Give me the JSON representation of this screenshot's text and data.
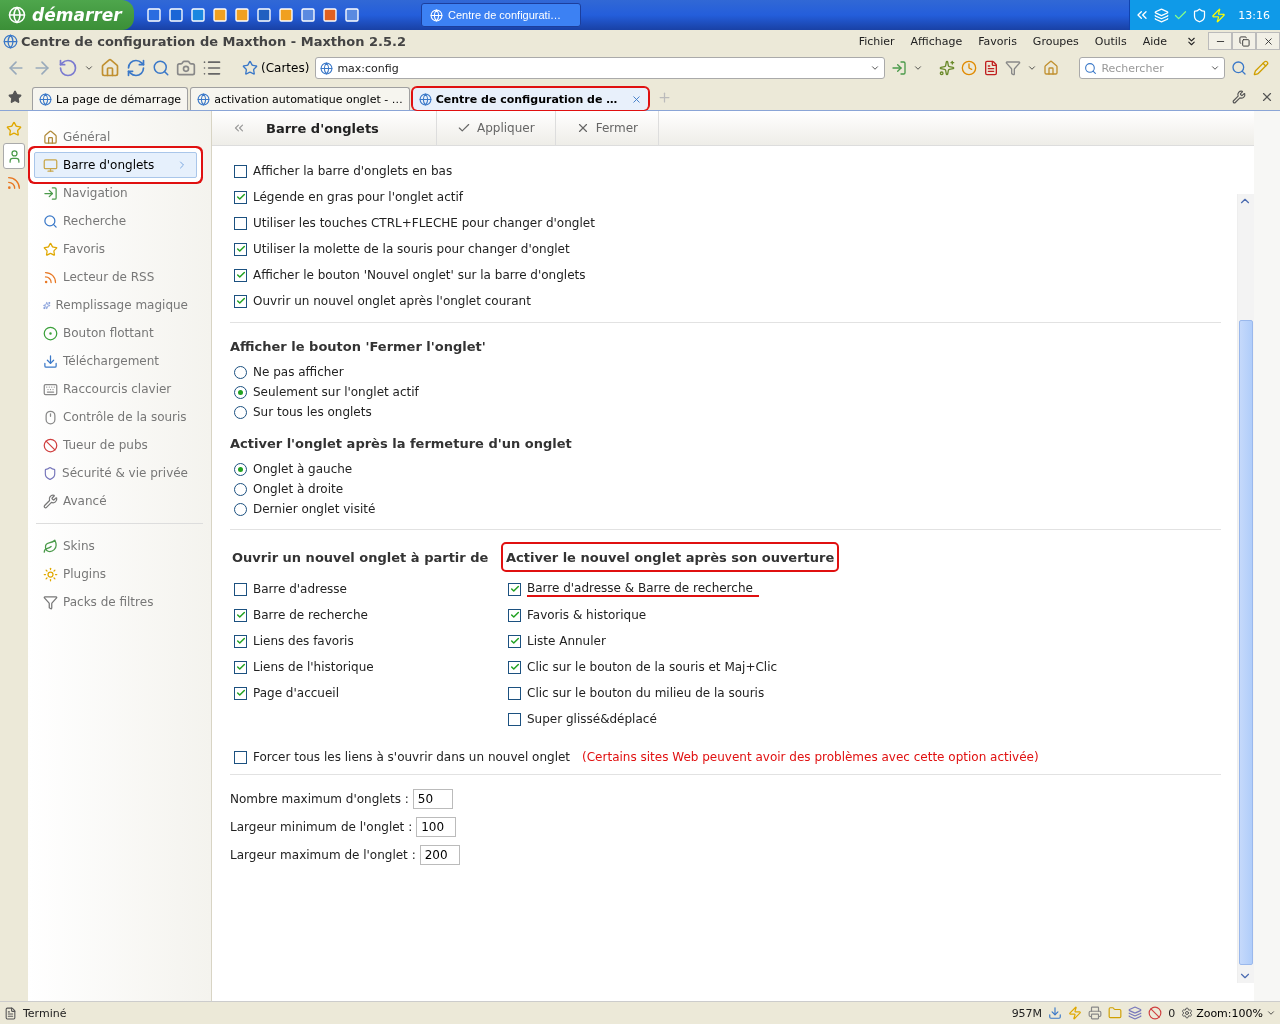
{
  "taskbar": {
    "start": "démarrer",
    "task": "Centre de configurati…",
    "clock": "13:16"
  },
  "window": {
    "title": "Centre de configuration de Maxthon - Maxthon 2.5.2"
  },
  "menu": [
    "Fichier",
    "Affichage",
    "Favoris",
    "Groupes",
    "Outils",
    "Aide"
  ],
  "toolbar": {
    "cartes": "(Cartes)",
    "address": "max:config",
    "search_placeholder": "Rechercher"
  },
  "tabs": [
    {
      "label": "La page de démarrage",
      "selected": false,
      "highlighted": false
    },
    {
      "label": "activation automatique onglet - …",
      "selected": false,
      "highlighted": false
    },
    {
      "label": "Centre de configuration de …",
      "selected": true,
      "highlighted": true
    }
  ],
  "sidebar": {
    "items": [
      {
        "label": "Général",
        "selected": false,
        "highlighted": false
      },
      {
        "label": "Barre d'onglets",
        "selected": true,
        "highlighted": true
      },
      {
        "label": "Navigation",
        "selected": false,
        "highlighted": false
      },
      {
        "label": "Recherche",
        "selected": false,
        "highlighted": false
      },
      {
        "label": "Favoris",
        "selected": false,
        "highlighted": false
      },
      {
        "label": "Lecteur de RSS",
        "selected": false,
        "highlighted": false
      },
      {
        "label": "Remplissage magique",
        "selected": false,
        "highlighted": false
      },
      {
        "label": "Bouton flottant",
        "selected": false,
        "highlighted": false
      },
      {
        "label": "Téléchargement",
        "selected": false,
        "highlighted": false
      },
      {
        "label": "Raccourcis clavier",
        "selected": false,
        "highlighted": false
      },
      {
        "label": "Contrôle de la souris",
        "selected": false,
        "highlighted": false
      },
      {
        "label": "Tueur de pubs",
        "selected": false,
        "highlighted": false
      },
      {
        "label": "Sécurité & vie privée",
        "selected": false,
        "highlighted": false
      },
      {
        "label": "Avancé",
        "selected": false,
        "highlighted": false
      }
    ],
    "extras": [
      {
        "label": "Skins",
        "selected": false,
        "highlighted": false
      },
      {
        "label": "Plugins",
        "selected": false,
        "highlighted": false
      },
      {
        "label": "Packs de filtres",
        "selected": false,
        "highlighted": false
      }
    ]
  },
  "panel": {
    "title": "Barre d'onglets",
    "buttons": [
      "Appliquer",
      "Fermer"
    ]
  },
  "options": [
    {
      "label": "Afficher la barre d'onglets en bas",
      "checked": false
    },
    {
      "label": "Légende en gras pour l'onglet actif",
      "checked": true
    },
    {
      "label": "Utiliser les touches CTRL+FLECHE pour changer d'onglet",
      "checked": false
    },
    {
      "label": "Utiliser la molette de la souris pour changer d'onglet",
      "checked": true
    },
    {
      "label": "Afficher le bouton 'Nouvel onglet' sur la barre d'onglets",
      "checked": true
    },
    {
      "label": "Ouvrir un nouvel onglet après l'onglet courant",
      "checked": true
    }
  ],
  "radio_groups": [
    {
      "title": "Afficher le bouton 'Fermer l'onglet'",
      "items": [
        {
          "label": "Ne pas afficher",
          "selected": false
        },
        {
          "label": "Seulement sur l'onglet actif",
          "selected": true
        },
        {
          "label": "Sur tous les onglets",
          "selected": false
        }
      ]
    },
    {
      "title": "Activer l'onglet après la fermeture d'un onglet",
      "items": [
        {
          "label": "Onglet à gauche",
          "selected": true
        },
        {
          "label": "Onglet à droite",
          "selected": false
        },
        {
          "label": "Dernier onglet visité",
          "selected": false
        }
      ]
    }
  ],
  "columns": [
    {
      "title": "Ouvrir un nouvel onglet à partir de",
      "highlighted": false,
      "items": [
        {
          "label": "Barre d'adresse",
          "checked": false,
          "highlighted": false
        },
        {
          "label": "Barre de recherche",
          "checked": true,
          "highlighted": false
        },
        {
          "label": "Liens des favoris",
          "checked": true,
          "highlighted": false
        },
        {
          "label": "Liens de l'historique",
          "checked": true,
          "highlighted": false
        },
        {
          "label": "Page d'accueil",
          "checked": true,
          "highlighted": false
        }
      ]
    },
    {
      "title": "Activer le nouvel onglet après son ouverture",
      "highlighted": true,
      "items": [
        {
          "label": "Barre d'adresse & Barre de recherche",
          "checked": true,
          "highlighted": true
        },
        {
          "label": "Favoris & historique",
          "checked": true,
          "highlighted": false
        },
        {
          "label": "Liste Annuler",
          "checked": true,
          "highlighted": false
        },
        {
          "label": "Clic sur le bouton de la souris et Maj+Clic",
          "checked": true,
          "highlighted": false
        },
        {
          "label": "Clic sur le bouton du milieu de la souris",
          "checked": false,
          "highlighted": false
        },
        {
          "label": "Super glissé&déplacé",
          "checked": false,
          "highlighted": false
        }
      ]
    }
  ],
  "force": {
    "label": "Forcer tous les liens à s'ouvrir dans un nouvel onglet",
    "checked": false,
    "warning": "(Certains sites Web peuvent avoir des problèmes avec cette option activée)"
  },
  "numbers": [
    {
      "label": "Nombre maximum d'onglets :",
      "value": "50"
    },
    {
      "label": "Largeur minimum de l'onglet :",
      "value": "100"
    },
    {
      "label": "Largeur maximum de l'onglet :",
      "value": "200"
    }
  ],
  "status_bar": {
    "text": "Terminé",
    "memory": "957M",
    "count": "0",
    "zoom": "Zoom:100%"
  }
}
